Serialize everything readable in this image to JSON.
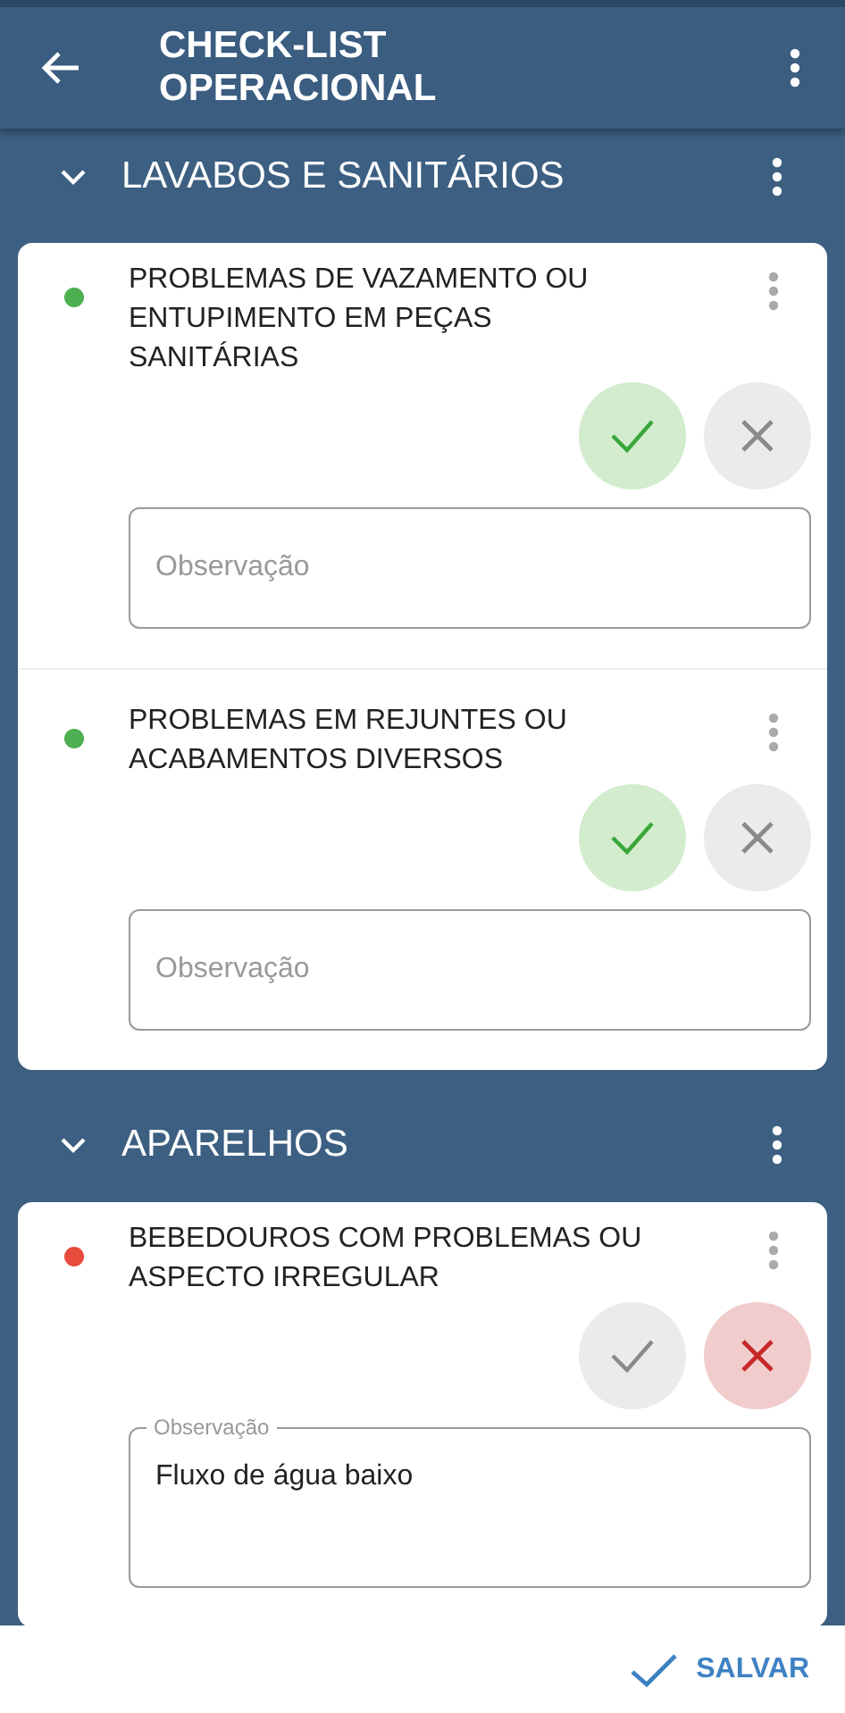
{
  "app_bar": {
    "title": "CHECK-LIST OPERACIONAL"
  },
  "sections": [
    {
      "title": "LAVABOS E SANITÁRIOS",
      "expanded": true,
      "items": [
        {
          "title": "PROBLEMAS DE VAZAMENTO OU ENTUPIMENTO EM PEÇAS SANITÁRIAS",
          "color": "#4caf50",
          "approve_selected": true,
          "reject_selected": false,
          "observation": {
            "placeholder": "Observação"
          }
        },
        {
          "title": "PROBLEMAS EM REJUNTES OU ACABAMENTOS DIVERSOS",
          "color": "#4caf50",
          "approve_selected": true,
          "reject_selected": false,
          "observation": {
            "placeholder": "Observação"
          }
        }
      ]
    },
    {
      "title": "APARELHOS",
      "expanded": true,
      "items": [
        {
          "title": "BEBEDOUROS COM PROBLEMAS OU ASPECTO IRREGULAR",
          "color": "#e74c3c",
          "approve_selected": false,
          "reject_selected": true,
          "observation": {
            "label": "Observação",
            "value": "Fluxo de água baixo"
          }
        }
      ]
    }
  ],
  "footer": {
    "save_button": "SALVAR"
  }
}
